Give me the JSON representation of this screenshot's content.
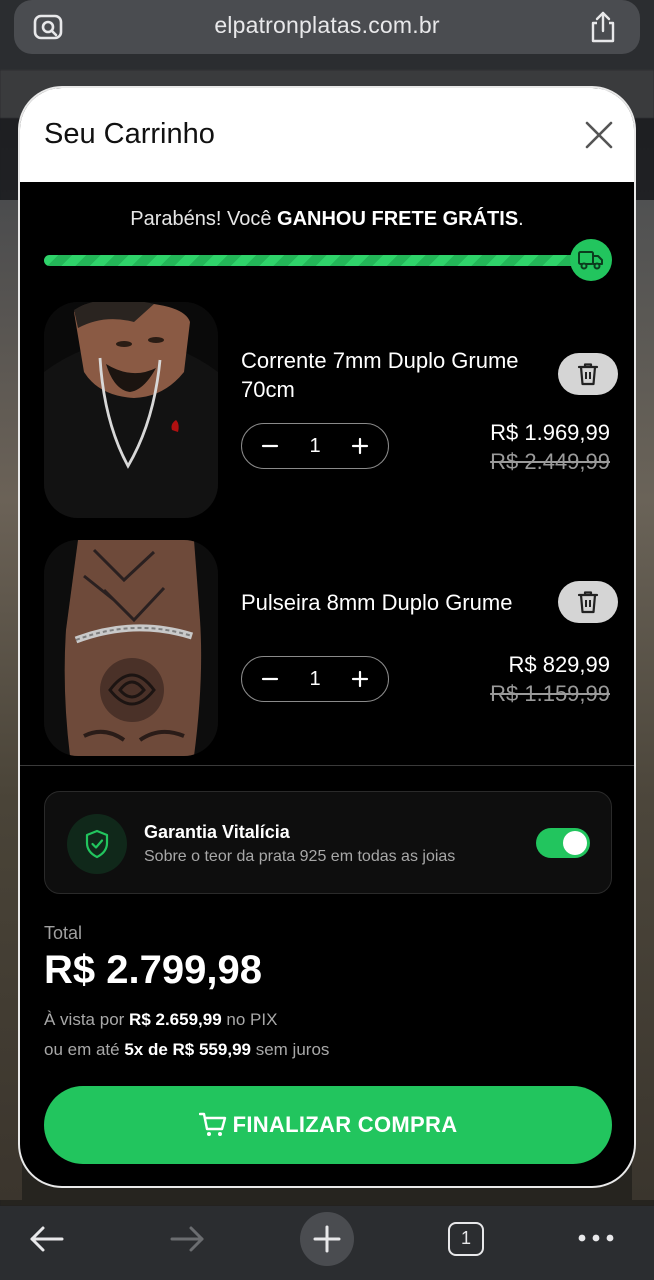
{
  "browser": {
    "url": "elpatronplatas.com.br",
    "tab_count": "1",
    "icons": [
      "page-settings-icon",
      "share-icon",
      "back-icon",
      "forward-icon",
      "new-tab-icon",
      "tabs-icon",
      "more-icon"
    ]
  },
  "cart": {
    "title": "Seu Carrinho",
    "shipping": {
      "prefix": "Parabéns! Você ",
      "highlight": "GANHOU FRETE GRÁTIS",
      "suffix": ".",
      "progress": 1.0
    },
    "items": [
      {
        "name": "Corrente 7mm Duplo Grume 70cm",
        "quantity": "1",
        "price": "R$ 1.969,99",
        "old_price": "R$ 2.449,99"
      },
      {
        "name": "Pulseira 8mm Duplo Grume",
        "quantity": "1",
        "price": "R$ 829,99",
        "old_price": "R$ 1.159,99"
      }
    ],
    "warranty": {
      "title": "Garantia Vitalícia",
      "subtitle": "Sobre o teor da prata 925 em todas as joias",
      "enabled": true
    },
    "total": {
      "label": "Total",
      "value": "R$ 2.799,98",
      "pix_prefix": "À vista por ",
      "pix_value": "R$ 2.659,99",
      "pix_suffix": " no PIX",
      "install_prefix": "ou em até ",
      "install_value": "5x de R$ 559,99",
      "install_suffix": " sem juros"
    },
    "checkout_label": "FINALIZAR COMPRA"
  },
  "colors": {
    "accent_green": "#22c55e",
    "modal_bg": "#000000",
    "header_bg": "#ffffff"
  }
}
